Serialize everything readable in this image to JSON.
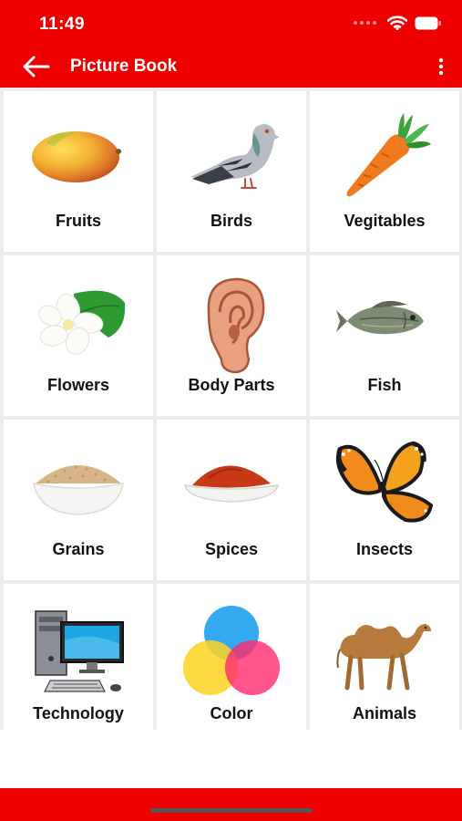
{
  "status_bar": {
    "time": "11:49",
    "icons": [
      "cellular-dots-icon",
      "wifi-icon",
      "battery-icon"
    ]
  },
  "app_bar": {
    "back_icon": "back-arrow-icon",
    "title": "Picture Book",
    "menu_icon": "more-vertical-icon"
  },
  "categories": [
    {
      "label": "Fruits",
      "icon": "mango-image"
    },
    {
      "label": "Birds",
      "icon": "pigeon-image"
    },
    {
      "label": "Vegitables",
      "icon": "carrot-image"
    },
    {
      "label": "Flowers",
      "icon": "jasmine-flower-image"
    },
    {
      "label": "Body Parts",
      "icon": "ear-image"
    },
    {
      "label": "Fish",
      "icon": "fish-image"
    },
    {
      "label": "Grains",
      "icon": "grains-bowl-image"
    },
    {
      "label": "Spices",
      "icon": "spice-bowl-image"
    },
    {
      "label": "Insects",
      "icon": "butterfly-image"
    },
    {
      "label": "Technology",
      "icon": "computer-image"
    },
    {
      "label": "Color",
      "icon": "color-circles-image"
    },
    {
      "label": "Animals",
      "icon": "camel-image"
    }
  ],
  "colors": {
    "brand_red": "#ef0000",
    "grid_background": "#ececec",
    "tile_background": "#ffffff"
  }
}
